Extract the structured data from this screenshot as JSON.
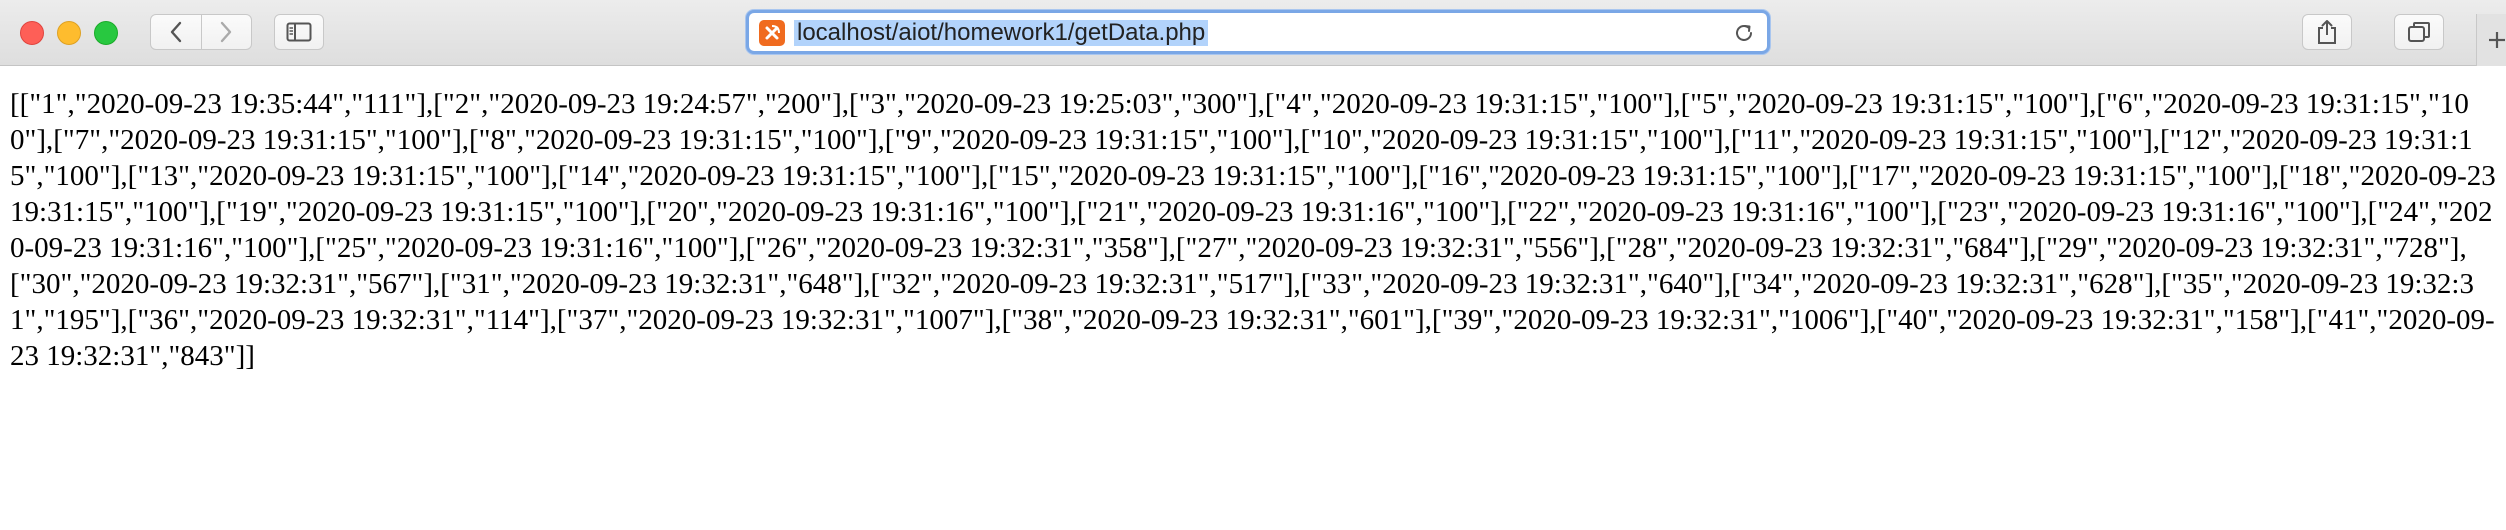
{
  "browser": {
    "url": "localhost/aiot/homework1/getData.php",
    "icons": {
      "close": "close-traffic-light",
      "minimize": "minimize-traffic-light",
      "zoom": "zoom-traffic-light",
      "back": "chevron-left-icon",
      "forward": "chevron-right-icon",
      "sidebar": "sidebar-icon",
      "site": "xampp-icon",
      "reload": "reload-icon",
      "share": "share-icon",
      "tabs": "tab-overview-icon",
      "new_tab": "plus-icon"
    },
    "colors": {
      "selection": "#b2d3fb",
      "url_focus_ring": "#7aa7e6",
      "site_icon": "#f06b1f"
    }
  },
  "page": {
    "body_text": "[[\"1\",\"2020-09-23 19:35:44\",\"111\"],[\"2\",\"2020-09-23 19:24:57\",\"200\"],[\"3\",\"2020-09-23 19:25:03\",\"300\"],[\"4\",\"2020-09-23 19:31:15\",\"100\"],[\"5\",\"2020-09-23 19:31:15\",\"100\"],[\"6\",\"2020-09-23 19:31:15\",\"100\"],[\"7\",\"2020-09-23 19:31:15\",\"100\"],[\"8\",\"2020-09-23 19:31:15\",\"100\"],[\"9\",\"2020-09-23 19:31:15\",\"100\"],[\"10\",\"2020-09-23 19:31:15\",\"100\"],[\"11\",\"2020-09-23 19:31:15\",\"100\"],[\"12\",\"2020-09-23 19:31:15\",\"100\"],[\"13\",\"2020-09-23 19:31:15\",\"100\"],[\"14\",\"2020-09-23 19:31:15\",\"100\"],[\"15\",\"2020-09-23 19:31:15\",\"100\"],[\"16\",\"2020-09-23 19:31:15\",\"100\"],[\"17\",\"2020-09-23 19:31:15\",\"100\"],[\"18\",\"2020-09-23 19:31:15\",\"100\"],[\"19\",\"2020-09-23 19:31:15\",\"100\"],[\"20\",\"2020-09-23 19:31:16\",\"100\"],[\"21\",\"2020-09-23 19:31:16\",\"100\"],[\"22\",\"2020-09-23 19:31:16\",\"100\"],[\"23\",\"2020-09-23 19:31:16\",\"100\"],[\"24\",\"2020-09-23 19:31:16\",\"100\"],[\"25\",\"2020-09-23 19:31:16\",\"100\"],[\"26\",\"2020-09-23 19:32:31\",\"358\"],[\"27\",\"2020-09-23 19:32:31\",\"556\"],[\"28\",\"2020-09-23 19:32:31\",\"684\"],[\"29\",\"2020-09-23 19:32:31\",\"728\"],[\"30\",\"2020-09-23 19:32:31\",\"567\"],[\"31\",\"2020-09-23 19:32:31\",\"648\"],[\"32\",\"2020-09-23 19:32:31\",\"517\"],[\"33\",\"2020-09-23 19:32:31\",\"640\"],[\"34\",\"2020-09-23 19:32:31\",\"628\"],[\"35\",\"2020-09-23 19:32:31\",\"195\"],[\"36\",\"2020-09-23 19:32:31\",\"114\"],[\"37\",\"2020-09-23 19:32:31\",\"1007\"],[\"38\",\"2020-09-23 19:32:31\",\"601\"],[\"39\",\"2020-09-23 19:32:31\",\"1006\"],[\"40\",\"2020-09-23 19:32:31\",\"158\"],[\"41\",\"2020-09-23 19:32:31\",\"843\"]]"
  }
}
